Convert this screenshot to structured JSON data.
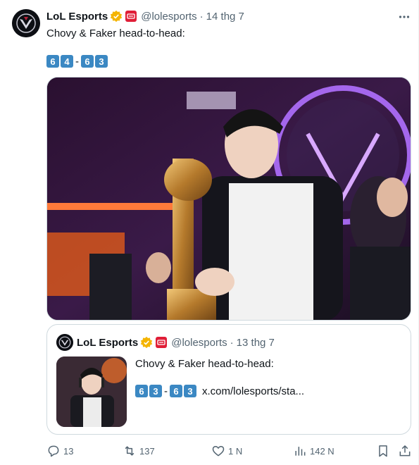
{
  "tweet": {
    "author_name": "LoL Esports",
    "handle": "@lolesports",
    "separator": "·",
    "time": "14 thg 7",
    "text": "Chovy & Faker head-to-head:",
    "score": {
      "left": [
        "6",
        "4"
      ],
      "dash": "-",
      "right": [
        "6",
        "3"
      ]
    }
  },
  "quote": {
    "author_name": "LoL Esports",
    "handle": "@lolesports",
    "separator": "·",
    "time": "13 thg 7",
    "text": "Chovy & Faker head-to-head:",
    "score": {
      "left": [
        "6",
        "3"
      ],
      "dash": "-",
      "right": [
        "6",
        "3"
      ]
    },
    "link": "x.com/lolesports/sta..."
  },
  "actions": {
    "replies": "13",
    "reposts": "137",
    "likes": "1 N",
    "views": "142 N"
  },
  "colors": {
    "verified": "#f4b400",
    "affiliate": "#e01e37",
    "keycap": "#3b88c3",
    "muted": "#536471"
  },
  "icons": [
    "lol-logo-icon",
    "verified-badge-icon",
    "affiliate-badge-icon",
    "more-icon",
    "reply-icon",
    "repost-icon",
    "like-icon",
    "views-icon",
    "bookmark-icon",
    "share-icon"
  ]
}
